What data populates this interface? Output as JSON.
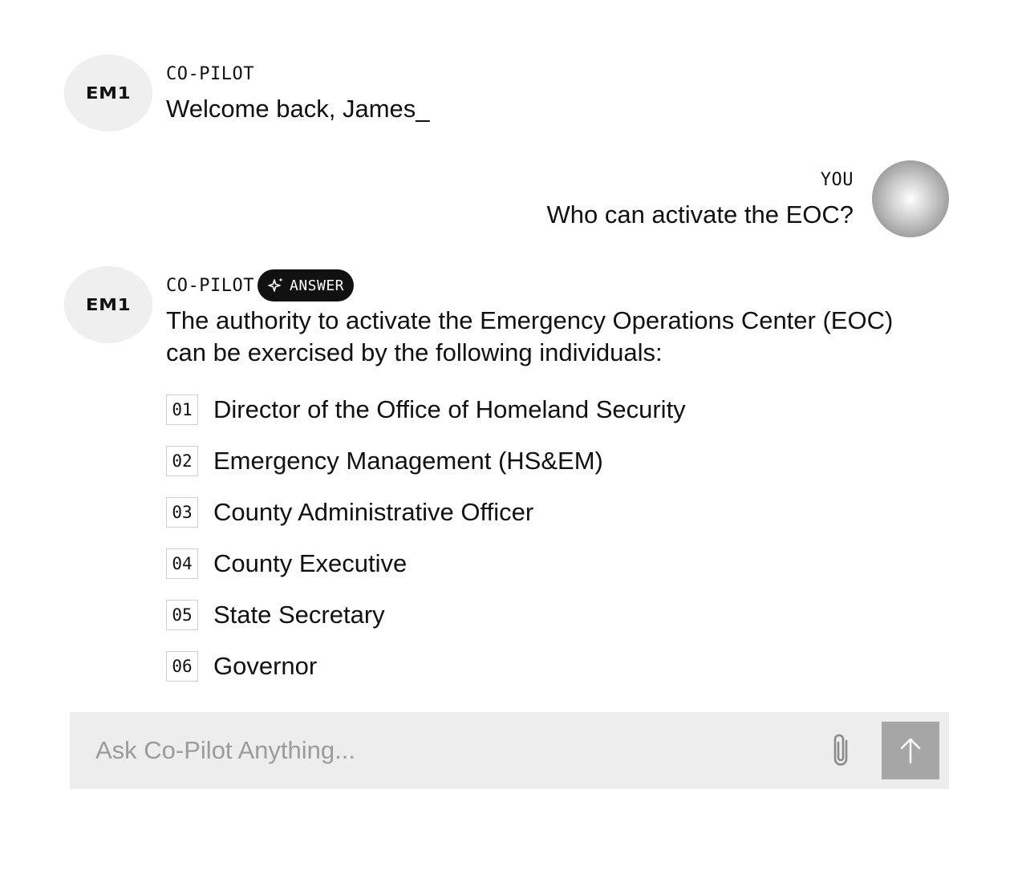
{
  "conversation": {
    "welcome": {
      "avatar": "EM1",
      "sender": "CO-PILOT",
      "text": "Welcome back, James_"
    },
    "user_message": {
      "sender": "YOU",
      "text": "Who can activate the EOC?",
      "avatar_icon": "user-avatar"
    },
    "answer": {
      "avatar": "EM1",
      "sender": "CO-PILOT",
      "badge_label": "ANSWER",
      "badge_icon": "sparkle-icon",
      "intro_line1": "The authority to activate the Emergency Operations Center (EOC)",
      "intro_line2": "can be exercised by the following individuals:",
      "items": [
        {
          "num": "01",
          "text": "Director of the Office of Homeland Security"
        },
        {
          "num": "02",
          "text": "Emergency Management (HS&EM)"
        },
        {
          "num": "03",
          "text": "County Administrative Officer"
        },
        {
          "num": "04",
          "text": "County Executive"
        },
        {
          "num": "05",
          "text": "State Secretary"
        },
        {
          "num": "06",
          "text": "Governor"
        }
      ]
    }
  },
  "composer": {
    "placeholder": "Ask Co-Pilot Anything...",
    "value": "",
    "attach_icon": "paperclip-icon",
    "send_icon": "arrow-up-icon"
  },
  "colors": {
    "badge_bg": "#111111",
    "composer_bg": "#ededed",
    "send_button_bg": "#a6a6a6",
    "avatar_bg": "#efefef"
  }
}
